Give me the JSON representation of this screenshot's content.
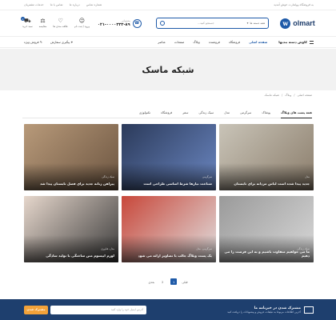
{
  "topbar": {
    "welcome": "به فروشگاه وولمارت خوش آمدید",
    "links": [
      "شماره تماس",
      "درباره ما",
      "تماس با ما",
      "خدمات مشتریان"
    ]
  },
  "header": {
    "logo_text": "olmart",
    "logo_mark": "w",
    "search_placeholder": "جستجو کنید...",
    "search_category": "همه دسته ها",
    "phone_label": "پشتیبانی",
    "phone_number": "۰۲۱-۰۰۰۰۳۳۳-۸۹",
    "icons": [
      {
        "label": "ورود / ثبت نام",
        "icon": "user-icon"
      },
      {
        "label": "علاقه مندی ها",
        "icon": "heart-icon"
      },
      {
        "label": "مقایسه",
        "icon": "compare-icon"
      },
      {
        "label": "سبد خرید",
        "icon": "cart-icon",
        "badge": "0"
      }
    ]
  },
  "nav": {
    "categories_label": "کاوش دسته بندیها",
    "menu": [
      "صفحه اصلی",
      "فروشگاه",
      "فروشنده",
      "وبلاگ",
      "صفحات",
      "عناصر"
    ],
    "left": [
      "پیگیری سفارش",
      "فروش ویژه"
    ]
  },
  "hero": {
    "title": "شبکه ماسک"
  },
  "breadcrumb": [
    "صفحه اصلی",
    "وبلاگ",
    "شبکه ماسک"
  ],
  "tabs": [
    "همه پست های وبلاگ",
    "پوشاک",
    "سرگرمی",
    "مدل",
    "سبک زندگی",
    "سفر",
    "فروشگاه",
    "تکنولوژی"
  ],
  "posts": [
    {
      "category": "مدل",
      "title": "جدید پیدا شده است لباس مردانه برای تابستان",
      "colors": [
        "#c9c4b8",
        "#8a7c6a"
      ]
    },
    {
      "category": "سرگرمی",
      "title": "شناخت نیازها شرط اساسی طراحی است",
      "colors": [
        "#2b3a5a",
        "#6b87c2"
      ]
    },
    {
      "category": "سبک زندگی",
      "title": "پیراهن زنانه جدید برای فصل تابستان پیدا شد",
      "colors": [
        "#b89a7a",
        "#6b5440"
      ]
    },
    {
      "category": "سبک زندگی",
      "title": "ما می خواهیم متفاوت باشیم و به این فرصت را می دهیم",
      "colors": [
        "#9a9a9a",
        "#d8d8d8"
      ]
    },
    {
      "category": "سرگرمی، مدل",
      "title": "یک پست وبلاگ جالب با تصاویر ارائه می شود",
      "colors": [
        "#c8473a",
        "#e0e0e0"
      ]
    },
    {
      "category": "مدل، فناوری",
      "title": "لورم ایپسوم متن ساختگی با تولید سادگی",
      "colors": [
        "#e6d7cc",
        "#3a3a3a"
      ]
    }
  ],
  "pagination": {
    "prev": "قبلی",
    "pages": [
      "1",
      "2"
    ],
    "next": "بعدی",
    "current": "1"
  },
  "newsletter": {
    "title": "مشترک شدن در خبرنامه ما",
    "subtitle": "آخرین اطلاعات مربوط به تبلیغات، فروش و پیشنهادات را دریافت کنید",
    "placeholder": "آدرس ایمیل خود را وارد کنید",
    "button": "مشترک شدن"
  }
}
